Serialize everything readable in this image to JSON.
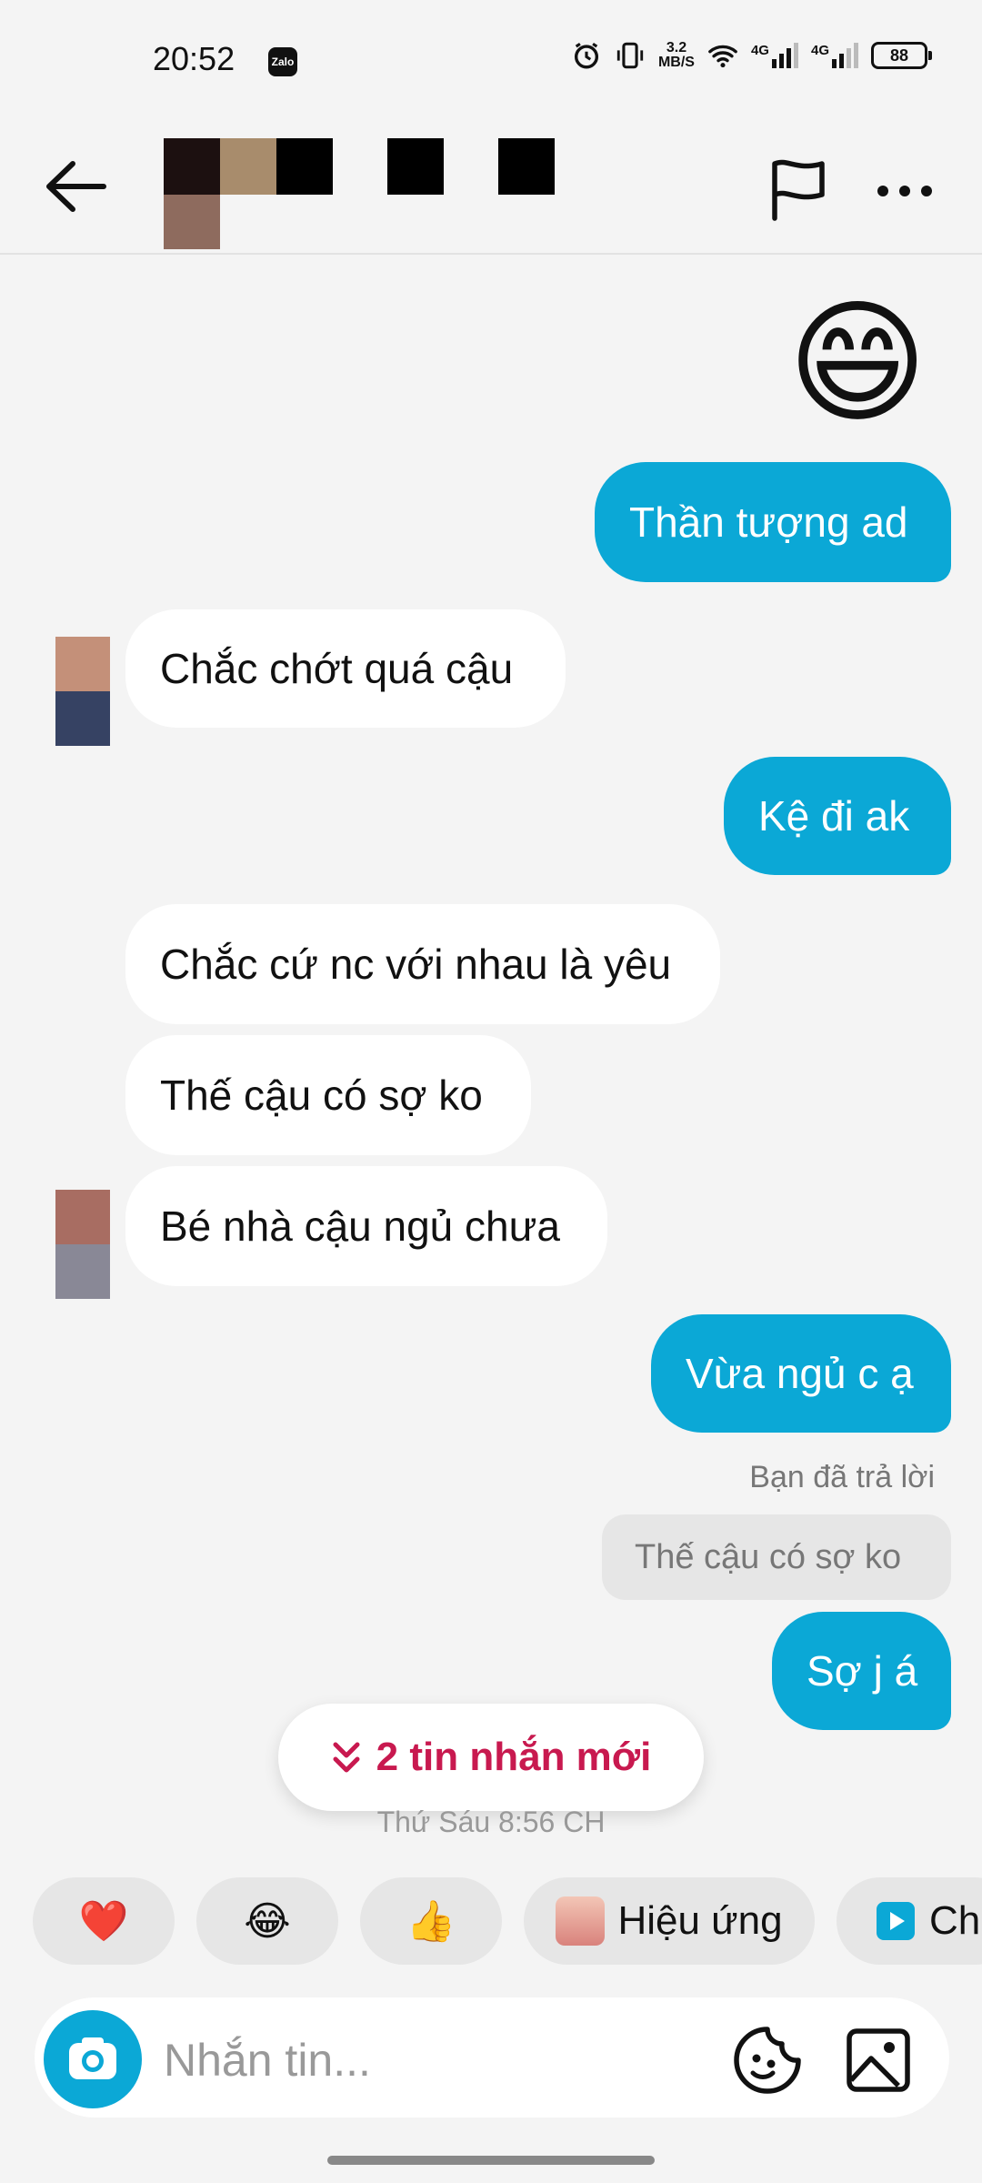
{
  "status_bar": {
    "time": "20:52",
    "app_badge": "Zalo",
    "net_speed_value": "3.2",
    "net_speed_unit": "MB/S",
    "sim1": "4G",
    "sim2": "4G",
    "battery": "88"
  },
  "header": {
    "back_icon": "arrow-left-icon",
    "report_icon": "flag-icon",
    "more_icon": "more-horizontal-icon"
  },
  "messages": [
    {
      "type": "sticker",
      "emoji": "😄"
    },
    {
      "type": "outgoing",
      "text": "Thần tượng ad"
    },
    {
      "type": "incoming",
      "text": "Chắc chớt quá cậu"
    },
    {
      "type": "outgoing",
      "text": "Kệ đi ak"
    },
    {
      "type": "incoming",
      "text": "Chắc cứ nc với nhau là yêu"
    },
    {
      "type": "incoming",
      "text": "Thế cậu có sợ ko"
    },
    {
      "type": "incoming",
      "text": "Bé nhà cậu ngủ chưa"
    },
    {
      "type": "outgoing",
      "text": "Vừa ngủ c ạ"
    },
    {
      "type": "outgoing",
      "text": "Sợ j á"
    }
  ],
  "reply": {
    "label": "Bạn đã trả lời",
    "quoted_text": "Thế cậu có sợ ko"
  },
  "new_messages_button": {
    "icon": "chevrons-down-icon",
    "label": "2 tin nhắn mới"
  },
  "date_separator": "Thứ Sáu 8:56 CH",
  "quick_reactions": [
    {
      "emoji": "❤️",
      "label": ""
    },
    {
      "emoji": "😂",
      "label": ""
    },
    {
      "emoji": "👍",
      "label": ""
    },
    {
      "emoji": "",
      "label": "Hiệu ứng"
    },
    {
      "emoji": "",
      "label": "Ch"
    }
  ],
  "composer": {
    "placeholder": "Nhắn tin...",
    "camera_icon": "camera-icon",
    "sticker_icon": "sticker-icon",
    "image_icon": "image-icon"
  },
  "colors": {
    "outgoing_bubble": "#0ba8d6",
    "incoming_bubble": "#ffffff",
    "background": "#f4f4f4",
    "new_messages_accent": "#c8194f"
  }
}
